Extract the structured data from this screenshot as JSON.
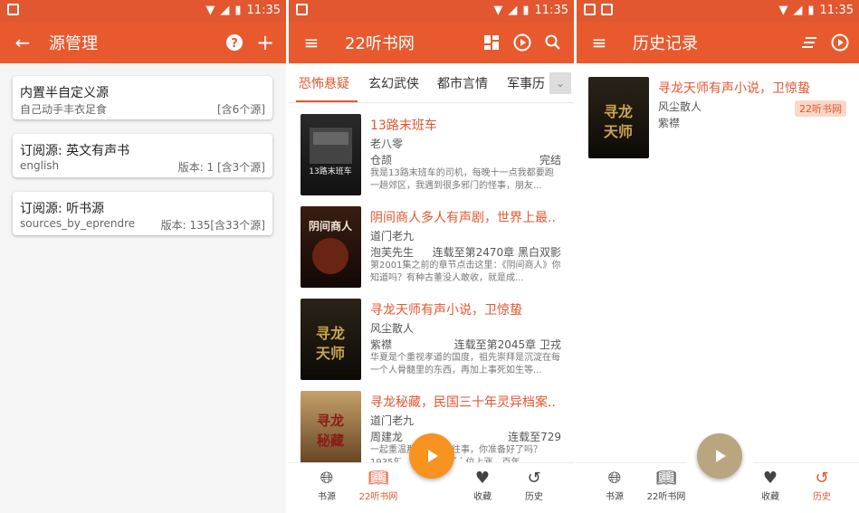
{
  "status": {
    "time": "11:35"
  },
  "colors": {
    "accent": "#e2572f",
    "toolbar": "#e85a2e",
    "fab_orange": "#f7931e",
    "fab_khaki": "#b9a57f"
  },
  "p1": {
    "title": "源管理",
    "cards": [
      {
        "title": "内置半自定义源",
        "sub": "自己动手丰衣足食",
        "right": "[含6个源]"
      },
      {
        "title": "订阅源: 英文有声书",
        "sub": "english",
        "right": "版本: 1 [含3个源]"
      },
      {
        "title": "订阅源: 听书源",
        "sub": "sources_by_eprendre",
        "right": "版本: 135[含33个源]"
      }
    ]
  },
  "p2": {
    "title": "22听书网",
    "tabs": [
      "恐怖悬疑",
      "玄幻武侠",
      "都市言情",
      "军事历"
    ],
    "books": [
      {
        "title": "13路末班车",
        "author": "老八零",
        "narrator": "仓颉",
        "status": "完结",
        "desc": "我是13路末班车的司机，每晚十一点我都要跑一趟郊区，我遇到很多邪门的怪事，朋友..."
      },
      {
        "title": "阴间商人多人有声剧，世界上最..",
        "author": "道门老九",
        "narrator": "泡芙先生",
        "status": "连载至第2470章 黑白双影",
        "desc": "第2001集之前的章节点击这里：《阴间商人》你知道吗？有种古董没人敢收，就是成..."
      },
      {
        "title": "寻龙天师有声小说，卫惊蛰",
        "author": "风尘散人",
        "narrator": "紫襟",
        "status": "连载至第2045章 卫戎",
        "desc": "华夏是个重视孝道的国度，祖先崇拜是沉淀在每一个人骨髓里的东西，再加上事死如生等..."
      },
      {
        "title": "寻龙秘藏，民国三十年灵异档案..",
        "author": "道门老九",
        "narrator": "周建龙",
        "status": "连载至729",
        "desc": "一起重温那些离奇的往事，你准备好了吗？1935年，黑龙江辽河水位上涨，百年..."
      }
    ],
    "nav": [
      "书源",
      "22听书网",
      "收藏",
      "历史"
    ]
  },
  "p3": {
    "title": "历史记录",
    "item": {
      "title": "寻龙天师有声小说，卫惊蛰",
      "author": "风尘散人",
      "narrator": "紫襟",
      "tag": "22听书网"
    },
    "nav": [
      "书源",
      "22听书网",
      "收藏",
      "历史"
    ]
  },
  "icons": {
    "back": "arrow-left-icon",
    "help": "help-circle-icon",
    "add": "plus-icon",
    "menu": "menu-icon",
    "grid": "grid-icon",
    "play": "play-circle-icon",
    "search": "search-icon",
    "sort": "sort-icon",
    "globe": "globe-icon",
    "book": "book-open-icon",
    "heart": "heart-icon",
    "history": "history-icon"
  }
}
